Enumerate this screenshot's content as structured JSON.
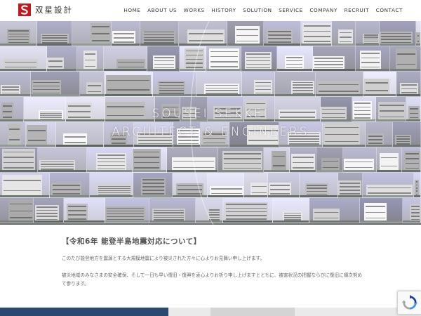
{
  "brand": {
    "mark": "S",
    "name": "双星設計",
    "accent": "#c8161d"
  },
  "nav": [
    {
      "label": "HOME"
    },
    {
      "label": "ABOUT US"
    },
    {
      "label": "WORKS"
    },
    {
      "label": "HISTORY"
    },
    {
      "label": "SOLUTION"
    },
    {
      "label": "SERVICE"
    },
    {
      "label": "COMPANY"
    },
    {
      "label": "RECRUIT"
    },
    {
      "label": "CONTACT"
    }
  ],
  "hero": {
    "line1": "SOUSEI   SEKKEI",
    "line2": "ARCHITECT & ENGINEERS"
  },
  "notice": {
    "title": "【令和6年 能登半島地震対応について】",
    "p1": "このたび能登地方を震源とする大規模地震により被災された方々に心よりお見舞い申し上げます。",
    "p2": "被災地域のみなさまの安全確保、そして一日も早い復旧・復興を衷心よりお祈り申し上げますとともに、被害状況の把握ならびに復旧に順次努めて参ります。"
  },
  "recaptcha": {
    "icon": "recaptcha-icon"
  }
}
